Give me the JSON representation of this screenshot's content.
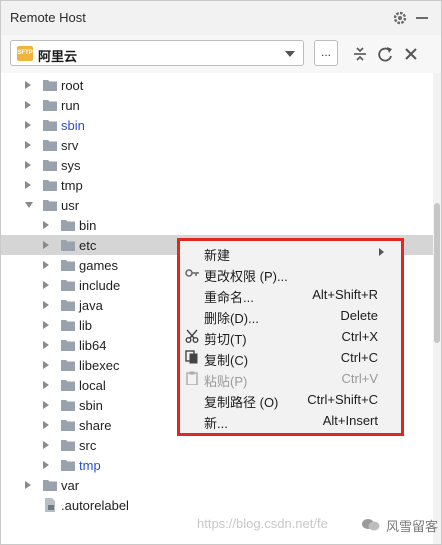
{
  "panel": {
    "title": "Remote Host"
  },
  "toolbar": {
    "host_selected": "阿里云",
    "host_icon_text": "SFTP",
    "more_label": "..."
  },
  "tree": [
    {
      "name": "root",
      "expanded": false
    },
    {
      "name": "run",
      "expanded": false
    },
    {
      "name": "sbin",
      "expanded": false,
      "highlight": true
    },
    {
      "name": "srv",
      "expanded": false
    },
    {
      "name": "sys",
      "expanded": false
    },
    {
      "name": "tmp",
      "expanded": false
    },
    {
      "name": "usr",
      "expanded": true
    },
    {
      "name": "bin",
      "expanded": false
    },
    {
      "name": "etc",
      "expanded": false,
      "selected": true
    },
    {
      "name": "games",
      "expanded": false
    },
    {
      "name": "include",
      "expanded": false
    },
    {
      "name": "java",
      "expanded": false
    },
    {
      "name": "lib",
      "expanded": false
    },
    {
      "name": "lib64",
      "expanded": false
    },
    {
      "name": "libexec",
      "expanded": false
    },
    {
      "name": "local",
      "expanded": false
    },
    {
      "name": "sbin",
      "expanded": false
    },
    {
      "name": "share",
      "expanded": false
    },
    {
      "name": "src",
      "expanded": false
    },
    {
      "name": "tmp",
      "expanded": false,
      "highlight": true
    },
    {
      "name": "var",
      "expanded": false
    },
    {
      "name": ".autorelabel",
      "type": "file"
    }
  ],
  "context_menu": [
    {
      "label": "新建",
      "shortcut": "",
      "submenu": true,
      "icon": ""
    },
    {
      "label": "更改权限 (P)...",
      "shortcut": "",
      "icon": "key-icon"
    },
    {
      "label": "重命名...",
      "shortcut": "Alt+Shift+R",
      "icon": ""
    },
    {
      "label": "删除(D)...",
      "shortcut": "Delete",
      "icon": ""
    },
    {
      "label": "剪切(T)",
      "shortcut": "Ctrl+X",
      "icon": "scissors-icon"
    },
    {
      "label": "复制(C)",
      "shortcut": "Ctrl+C",
      "icon": "copy-icon"
    },
    {
      "label": "粘贴(P)",
      "shortcut": "Ctrl+V",
      "icon": "paste-icon",
      "disabled": true
    },
    {
      "label": "复制路径 (O)",
      "shortcut": "Ctrl+Shift+C",
      "icon": ""
    },
    {
      "label": "新...",
      "shortcut": "Alt+Insert",
      "icon": ""
    }
  ],
  "watermark": {
    "url": "https://blog.csdn.net/fe",
    "author": "风雪留客"
  },
  "colors": {
    "menu_border": "#e0281e",
    "link_blue": "#2b4fcf",
    "selected_row": "#d5d5d5"
  }
}
